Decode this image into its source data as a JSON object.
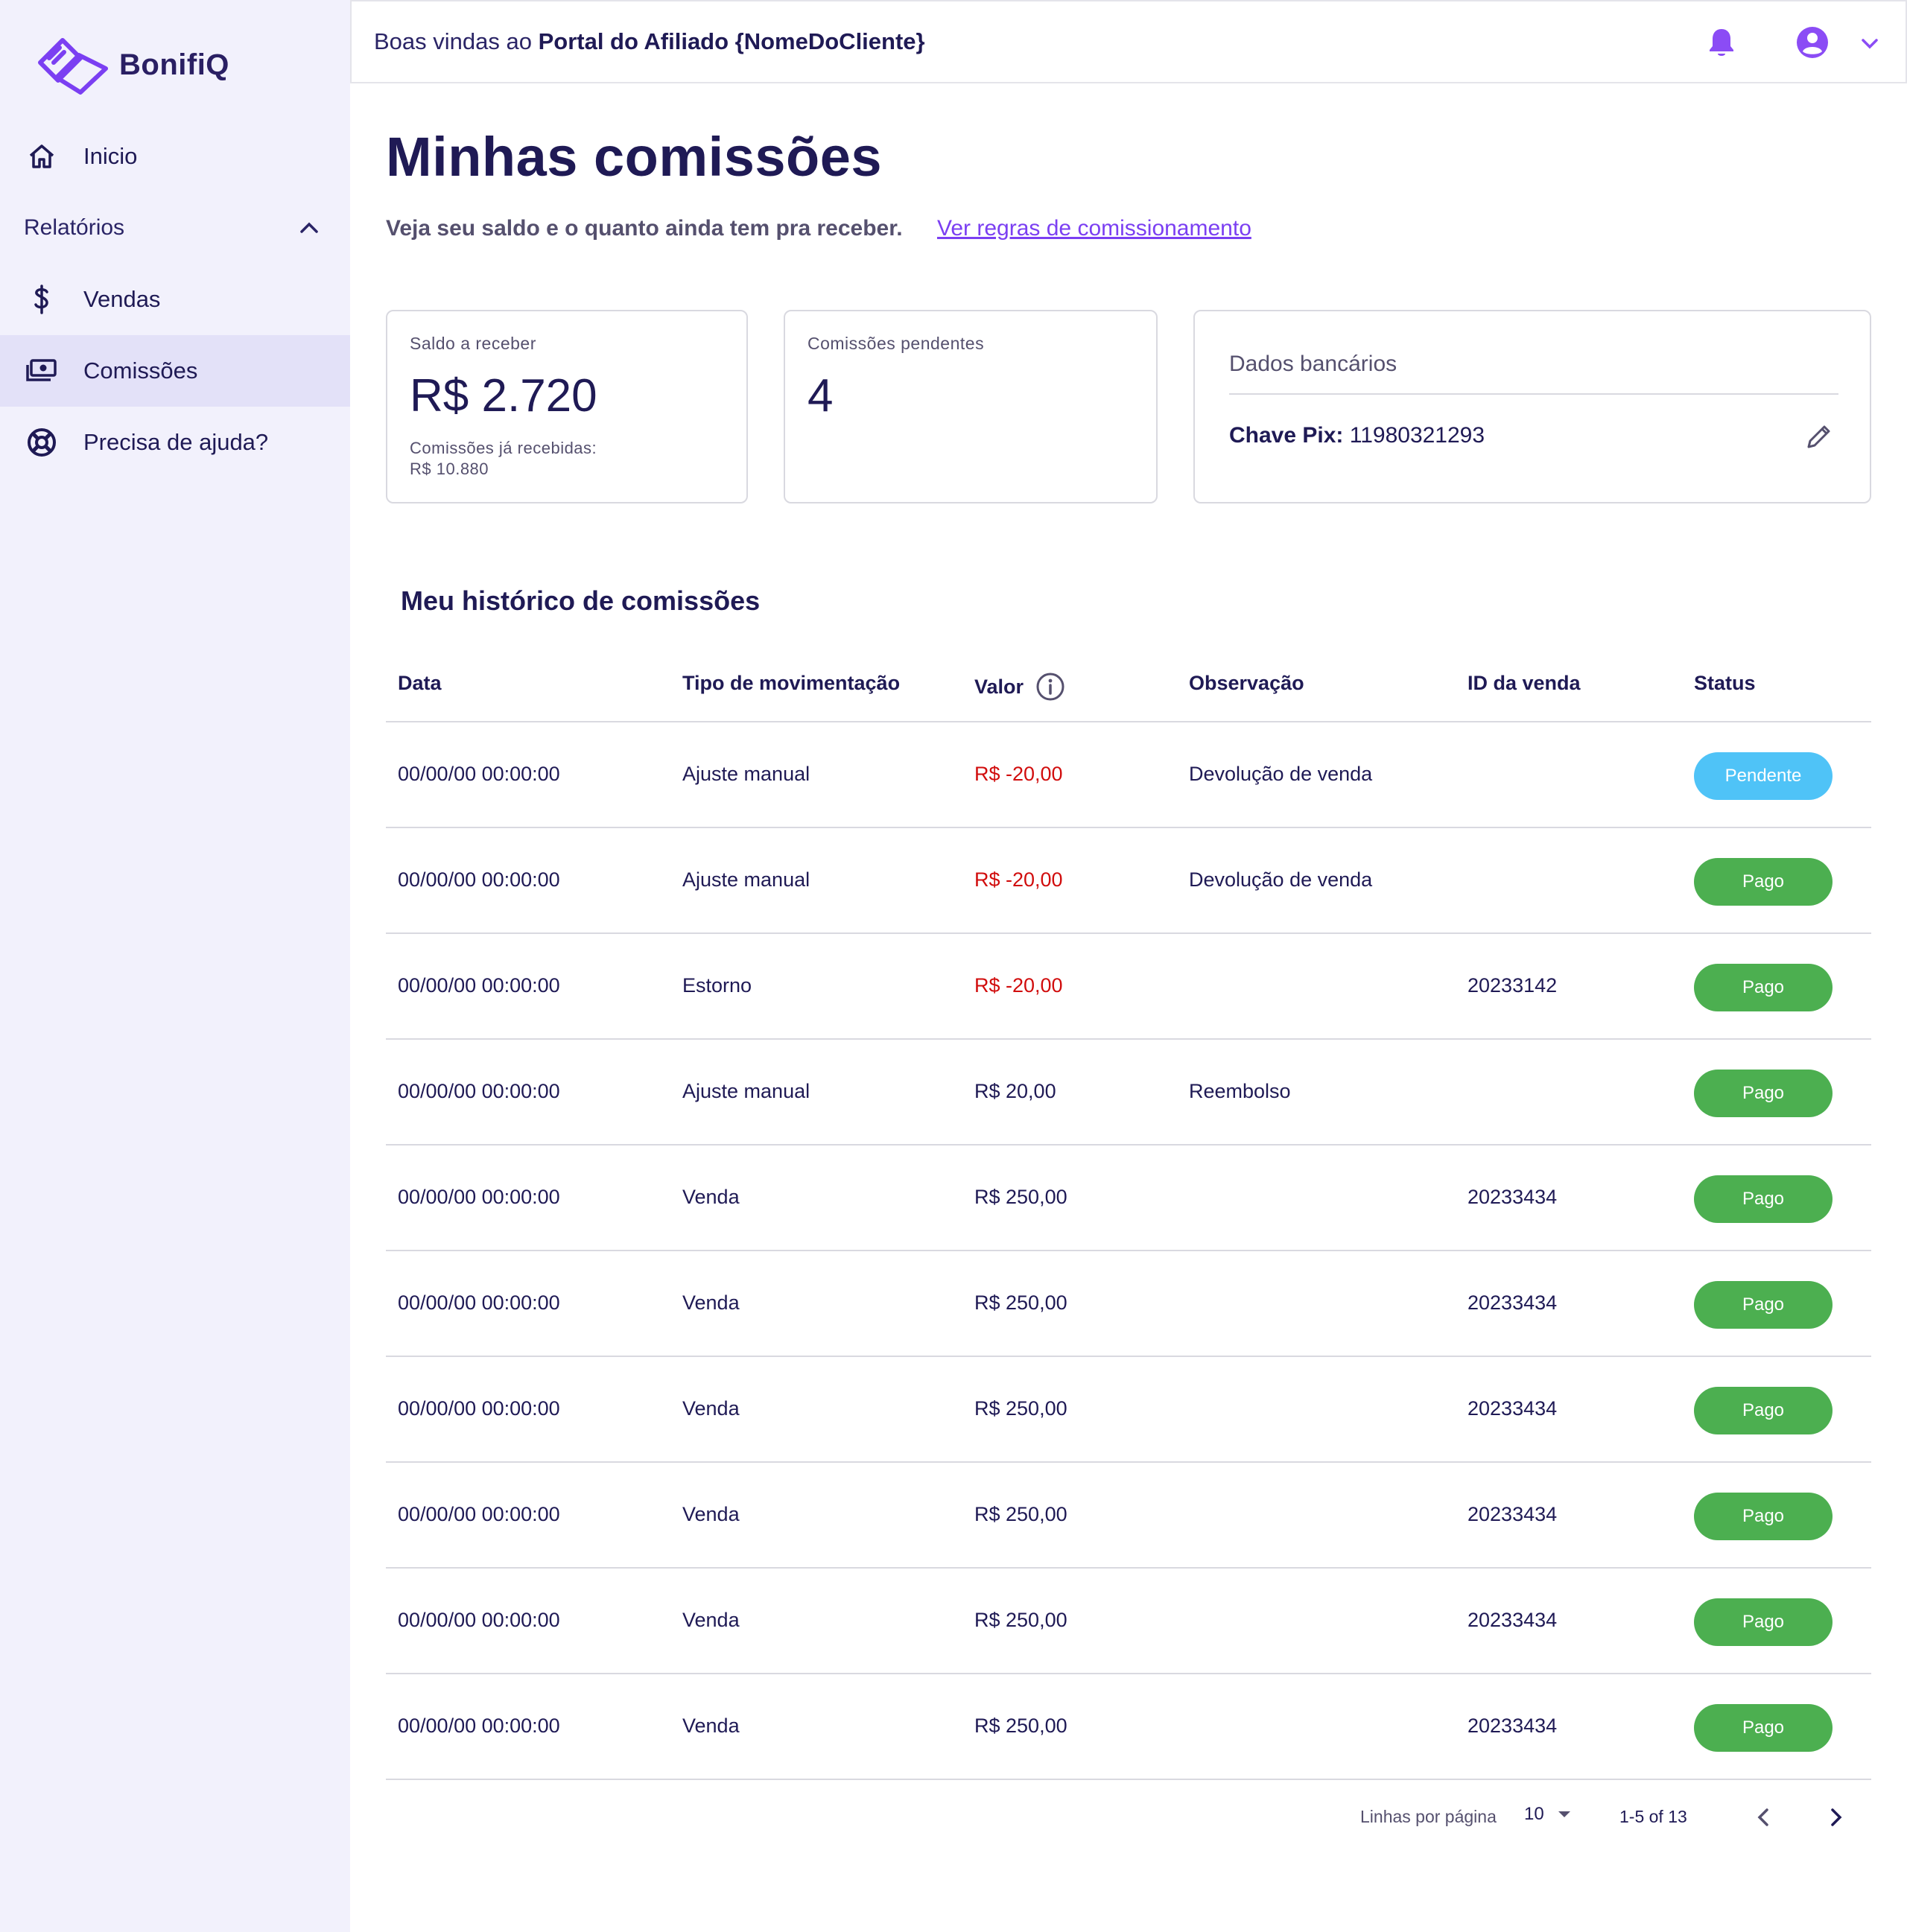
{
  "brand": {
    "name": "BonifiQ",
    "accent": "#7b3ff2"
  },
  "sidebar": {
    "home": {
      "label": "Inicio",
      "icon": "home-icon"
    },
    "reports": {
      "label": "Relatórios",
      "icon": "chevron-up-icon"
    },
    "sales": {
      "label": "Vendas",
      "icon": "dollar-icon"
    },
    "commissions": {
      "label": "Comissões",
      "icon": "money-icon"
    },
    "help": {
      "label": "Precisa de ajuda?",
      "icon": "lifebuoy-icon"
    }
  },
  "topbar": {
    "welcome_prefix": "Boas vindas ao ",
    "welcome_strong": "Portal do Afiliado {NomeDoCliente}"
  },
  "page": {
    "title": "Minhas comissões",
    "subtitle": "Veja seu saldo e o quanto ainda tem pra receber.",
    "rules_link": "Ver regras de comissionamento"
  },
  "cards": {
    "balance": {
      "label": "Saldo a receber",
      "value": "R$ 2.720",
      "note_label": "Comissões já recebidas:",
      "note_value": "R$ 10.880"
    },
    "pending": {
      "label": "Comissões pendentes",
      "value": "4"
    },
    "bank": {
      "title": "Dados bancários",
      "pix_label": "Chave Pix:",
      "pix_value": " 11980321293"
    }
  },
  "history": {
    "title": "Meu histórico de comissões",
    "columns": {
      "date": "Data",
      "type": "Tipo de movimentação",
      "value": "Valor",
      "obs": "Observação",
      "id": "ID da venda",
      "status": "Status"
    },
    "rows": [
      {
        "date": "00/00/00 00:00:00",
        "type": "Ajuste manual",
        "value": "R$ -20,00",
        "obs": "Devolução de venda",
        "id": "",
        "status": "Pendente"
      },
      {
        "date": "00/00/00 00:00:00",
        "type": "Ajuste manual",
        "value": "R$ -20,00",
        "obs": "Devolução de venda",
        "id": "",
        "status": "Pago"
      },
      {
        "date": "00/00/00 00:00:00",
        "type": "Estorno",
        "value": "R$ -20,00",
        "obs": "",
        "id": "20233142",
        "status": "Pago"
      },
      {
        "date": "00/00/00 00:00:00",
        "type": "Ajuste manual",
        "value": "R$ 20,00",
        "obs": "Reembolso",
        "id": "",
        "status": "Pago"
      },
      {
        "date": "00/00/00 00:00:00",
        "type": "Venda",
        "value": "R$ 250,00",
        "obs": "",
        "id": "20233434",
        "status": "Pago"
      },
      {
        "date": "00/00/00 00:00:00",
        "type": "Venda",
        "value": "R$ 250,00",
        "obs": "",
        "id": "20233434",
        "status": "Pago"
      },
      {
        "date": "00/00/00 00:00:00",
        "type": "Venda",
        "value": "R$ 250,00",
        "obs": "",
        "id": "20233434",
        "status": "Pago"
      },
      {
        "date": "00/00/00 00:00:00",
        "type": "Venda",
        "value": "R$ 250,00",
        "obs": "",
        "id": "20233434",
        "status": "Pago"
      },
      {
        "date": "00/00/00 00:00:00",
        "type": "Venda",
        "value": "R$ 250,00",
        "obs": "",
        "id": "20233434",
        "status": "Pago"
      },
      {
        "date": "00/00/00 00:00:00",
        "type": "Venda",
        "value": "R$ 250,00",
        "obs": "",
        "id": "20233434",
        "status": "Pago"
      }
    ],
    "status_colors": {
      "Pendente": "#4fc3f7",
      "Pago": "#4caf50"
    },
    "negative_color": "#d10d0d"
  },
  "pagination": {
    "rows_label": "Linhas por página",
    "rows_value": "10",
    "range": "1-5 of 13"
  }
}
